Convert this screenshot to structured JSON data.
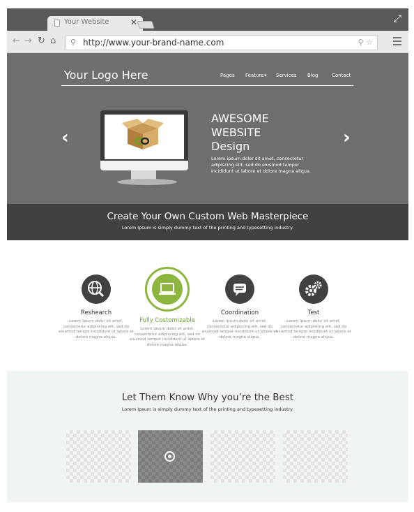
{
  "browser": {
    "tab_title": "Your Website",
    "url": "http://www.your-brand-name.com"
  },
  "hero": {
    "logo": "Your Logo Here",
    "nav": [
      "Pages",
      "Feature",
      "Services",
      "Blog",
      "Contact"
    ],
    "headline": [
      "AWESOME",
      "WEBSITE",
      "Design"
    ],
    "body": "Lorem ipsum dolor sit amet, consectetur adipiscing elit, sed do eiusmod tempor incididunt ut labore et dolore magna aliqua."
  },
  "banner": {
    "title": "Create Your Own Custom Web Masterpiece",
    "subtitle": "Lorem Ipsum is simply dummy text of the printing and typesetting industry."
  },
  "features": [
    {
      "title": "Reshearch",
      "text": "Lorem ipsum dolor sit amet, consectetur adipiscing elit, sed do eiusmod tempor incididunt ut labore et dolore magna aliqua."
    },
    {
      "title": "Fully Costomizable",
      "text": "Lorem ipsum dolor sit amet, consectetur adipiscing elit, sed do eiusmod tempor incididunt ut labore et dolore magna aliqua."
    },
    {
      "title": "Coordination",
      "text": "Lorem ipsum dolor sit amet, consectetur adipiscing elit, sed do eiusmod tempor incididunt ut labore et dolore magna aliqua."
    },
    {
      "title": "Test",
      "text": "Lorem ipsum dolor sit amet, consectetur adipiscing elit, sed do eiusmod tempor incididunt ut labore et dolore magna aliqua."
    }
  ],
  "showcase": {
    "title": "Let Them Know Why you’re the Best",
    "subtitle": "Lorem Ipsum is simply dummy text of the printing and typesetting industry."
  },
  "colors": {
    "hero_bg": "#6d6e70",
    "banner_bg": "#414042",
    "accent": "#8cb63d"
  }
}
